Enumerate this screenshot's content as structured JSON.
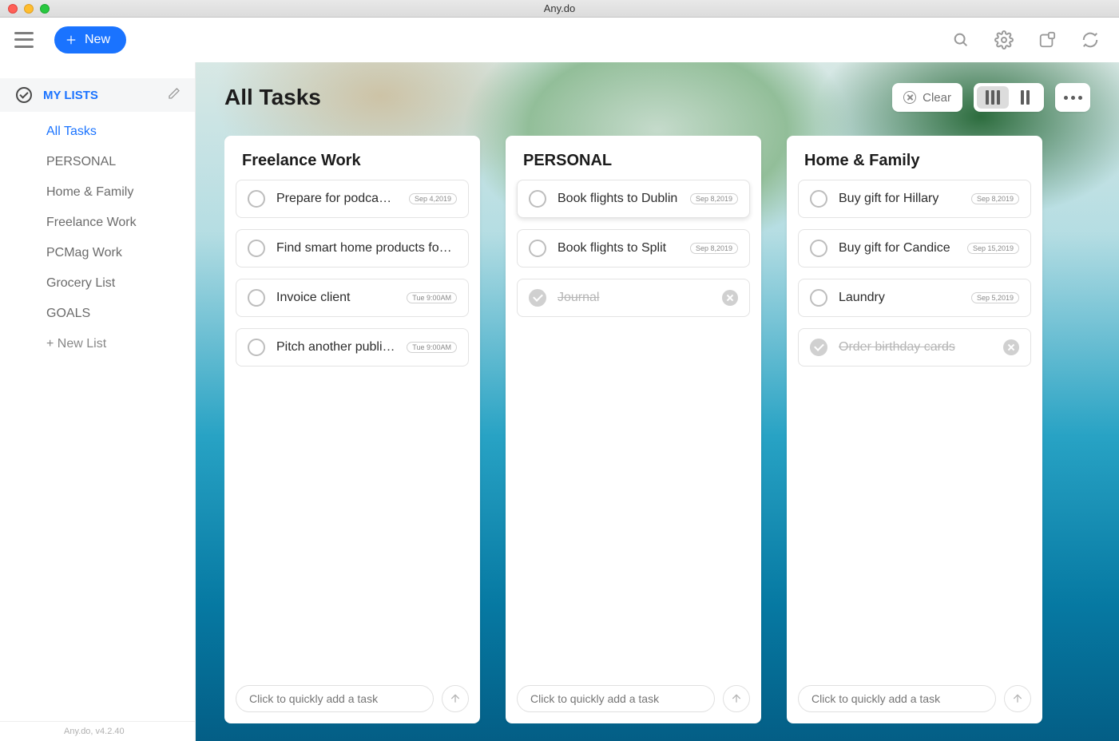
{
  "window": {
    "title": "Any.do"
  },
  "topbar": {
    "new_label": "New"
  },
  "sidebar": {
    "section_title": "MY LISTS",
    "items": [
      {
        "label": "All Tasks",
        "active": true
      },
      {
        "label": "PERSONAL"
      },
      {
        "label": "Home & Family"
      },
      {
        "label": "Freelance Work"
      },
      {
        "label": "PCMag Work"
      },
      {
        "label": "Grocery List"
      },
      {
        "label": "GOALS"
      }
    ],
    "new_list_label": "+ New List",
    "footer": "Any.do, v4.2.40"
  },
  "board": {
    "title": "All Tasks",
    "clear_label": "Clear",
    "quick_add_placeholder": "Click to quickly add a task",
    "columns": [
      {
        "title": "Freelance Work",
        "tasks": [
          {
            "label": "Prepare for podcast i…",
            "date": "Sep 4,2019",
            "done": false
          },
          {
            "label": "Find smart home products fo…",
            "date": "",
            "done": false
          },
          {
            "label": "Invoice client",
            "date": "Tue 9:00AM",
            "done": false
          },
          {
            "label": "Pitch another public…",
            "date": "Tue 9:00AM",
            "done": false
          }
        ]
      },
      {
        "title": "PERSONAL",
        "tasks": [
          {
            "label": "Book flights to Dublin",
            "date": "Sep 8,2019",
            "done": false,
            "hover": true
          },
          {
            "label": "Book flights to Split",
            "date": "Sep 8,2019",
            "done": false
          },
          {
            "label": "Journal",
            "date": "",
            "done": true
          }
        ]
      },
      {
        "title": "Home & Family",
        "tasks": [
          {
            "label": "Buy gift for Hillary",
            "date": "Sep 8,2019",
            "done": false
          },
          {
            "label": "Buy gift for Candice",
            "date": "Sep 15,2019",
            "done": false
          },
          {
            "label": "Laundry",
            "date": "Sep 5,2019",
            "done": false
          },
          {
            "label": "Order birthday cards",
            "date": "",
            "done": true
          }
        ]
      }
    ]
  }
}
